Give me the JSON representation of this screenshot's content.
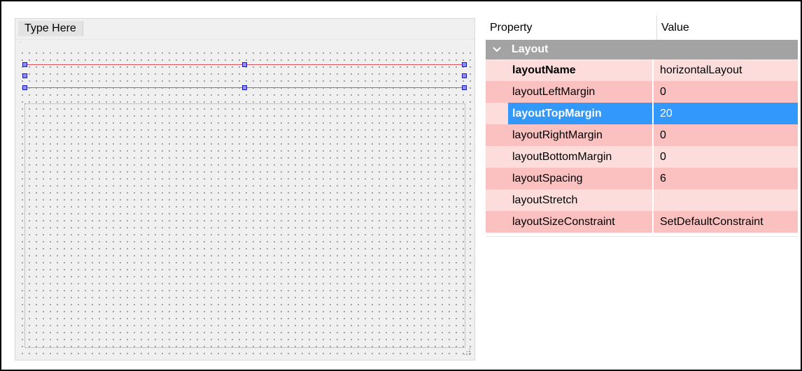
{
  "form": {
    "menubar_placeholder": "Type Here"
  },
  "property_editor": {
    "columns": {
      "property": "Property",
      "value": "Value"
    },
    "group": {
      "label": "Layout",
      "expanded": true,
      "icon": "chevron-down-icon"
    },
    "rows": [
      {
        "name": "layoutName",
        "value": "horizontalLayout",
        "bold": true,
        "shade": "light"
      },
      {
        "name": "layoutLeftMargin",
        "value": "0",
        "shade": "dark"
      },
      {
        "name": "layoutTopMargin",
        "value": "20",
        "selected": true
      },
      {
        "name": "layoutRightMargin",
        "value": "0",
        "shade": "dark"
      },
      {
        "name": "layoutBottomMargin",
        "value": "0",
        "shade": "light"
      },
      {
        "name": "layoutSpacing",
        "value": "6",
        "shade": "dark"
      },
      {
        "name": "layoutStretch",
        "value": "",
        "shade": "light"
      },
      {
        "name": "layoutSizeConstraint",
        "value": "SetDefaultConstraint",
        "shade": "dark"
      }
    ]
  },
  "colors": {
    "selection": "#3398fc",
    "row_light": "#fddcdc",
    "row_dark": "#fbc0c0",
    "group_header": "#a3a3a3",
    "layout_line": "#e0505a",
    "handle": "#8d8dff"
  }
}
